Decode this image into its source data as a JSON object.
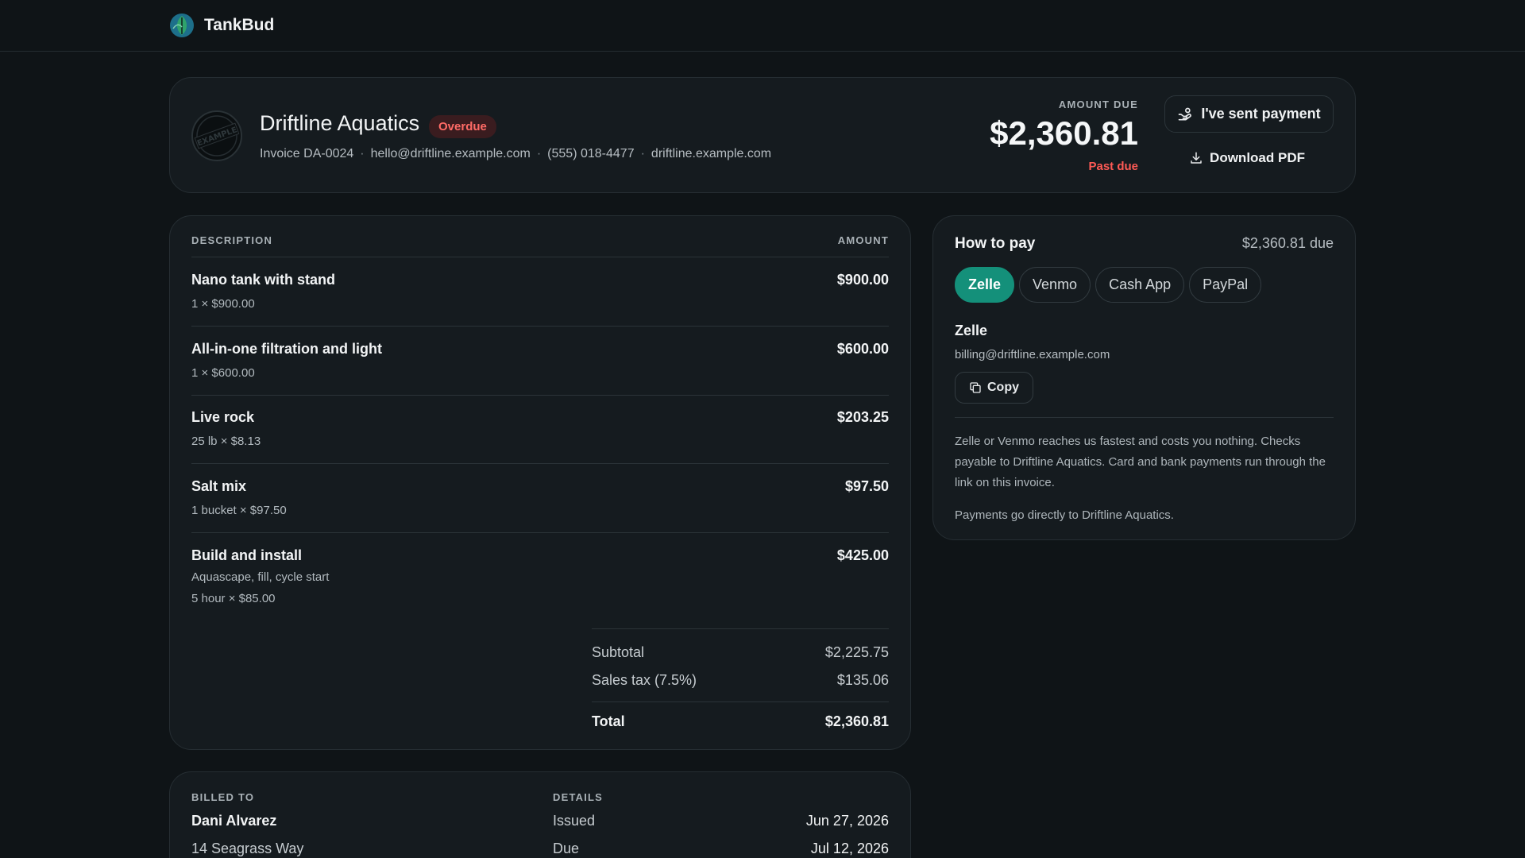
{
  "app": {
    "name": "TankBud"
  },
  "vendor": {
    "name": "Driftline Aquatics",
    "status": "Overdue",
    "logo_text": "EXAMPLE",
    "invoice": "Invoice DA-0024",
    "email": "hello@driftline.example.com",
    "phone": "(555) 018-4477",
    "website": "driftline.example.com"
  },
  "amount": {
    "label": "AMOUNT DUE",
    "value": "$2,360.81",
    "status": "Past due"
  },
  "actions": {
    "sent_label": "I've sent payment",
    "pdf_label": "Download PDF"
  },
  "items": {
    "col_description": "DESCRIPTION",
    "col_amount": "AMOUNT",
    "rows": [
      {
        "title": "Nano tank with stand",
        "sub": "1 × $900.00",
        "amount": "$900.00"
      },
      {
        "title": "All-in-one filtration and light",
        "sub": "1 × $600.00",
        "amount": "$600.00"
      },
      {
        "title": "Live rock",
        "sub": "25 lb × $8.13",
        "amount": "$203.25"
      },
      {
        "title": "Salt mix",
        "sub": "1 bucket × $97.50",
        "amount": "$97.50"
      },
      {
        "title": "Build and install",
        "note": "Aquascape, fill, cycle start",
        "sub": "5 hour × $85.00",
        "amount": "$425.00"
      }
    ],
    "subtotal_label": "Subtotal",
    "subtotal": "$2,225.75",
    "tax_label": "Sales tax (7.5%)",
    "tax": "$135.06",
    "total_label": "Total",
    "total": "$2,360.81"
  },
  "pay": {
    "title": "How to pay",
    "due": "$2,360.81 due",
    "methods": [
      "Zelle",
      "Venmo",
      "Cash App",
      "PayPal"
    ],
    "selected": "Zelle",
    "method_name": "Zelle",
    "method_handle": "billing@driftline.example.com",
    "copy_label": "Copy",
    "note": "Zelle or Venmo reaches us fastest and costs you nothing. Checks payable to Driftline Aquatics. Card and bank payments run through the link on this invoice.",
    "direct": "Payments go directly to Driftline Aquatics.",
    "accent": "#14907a"
  },
  "billed": {
    "label": "BILLED TO",
    "name": "Dani Alvarez",
    "address": "14 Seagrass Way",
    "details_label": "DETAILS",
    "issued_label": "Issued",
    "issued": "Jun 27, 2026",
    "due_label": "Due",
    "due": "Jul 12, 2026"
  },
  "colors": {
    "background": "#0f1417",
    "card": "#151b1f",
    "danger": "#ff5a55"
  },
  "icons": {
    "brand": "leaf-logo-icon",
    "sent": "hand-coins-icon",
    "pdf": "download-icon",
    "copy": "copy-icon"
  }
}
